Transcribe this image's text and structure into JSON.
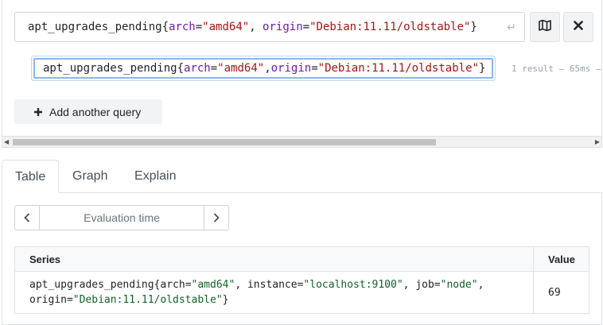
{
  "query": {
    "metric": "apt_upgrades_pending",
    "labels": [
      {
        "name": "arch",
        "value": "\"amd64\""
      },
      {
        "name": "origin",
        "value": "\"Debian:11.11/oldstable\""
      }
    ],
    "open_brace": "{",
    "close_brace": "}",
    "eq": "=",
    "comma_sp": ", ",
    "enter_glyph": "↵"
  },
  "subquery": {
    "metric": "apt_upgrades_pending",
    "open_brace": "{",
    "close_brace": "}",
    "eq": "=",
    "comma": ",",
    "labels": [
      {
        "name": "arch",
        "value": "\"amd64\""
      },
      {
        "name": "origin",
        "value": "\"Debian:11.11/oldstable\""
      }
    ],
    "meta": "1 result – 65ms –"
  },
  "buttons": {
    "add_query": "Add another query",
    "map_icon": "map-icon",
    "close_icon": "close-icon"
  },
  "tabs": [
    {
      "label": "Table",
      "active": true
    },
    {
      "label": "Graph",
      "active": false
    },
    {
      "label": "Explain",
      "active": false
    }
  ],
  "eval_time": {
    "placeholder": "Evaluation time",
    "prev": "‹",
    "next": "›"
  },
  "table": {
    "headers": {
      "series": "Series",
      "value": "Value"
    },
    "rows": [
      {
        "metric": "apt_upgrades_pending",
        "labels": [
          {
            "name": "arch",
            "value": "\"amd64\""
          },
          {
            "name": "instance",
            "value": "\"localhost:9100\""
          },
          {
            "name": "job",
            "value": "\"node\""
          },
          {
            "name": "origin",
            "value": "\"Debian:11.11/oldstable\""
          }
        ],
        "value": "69"
      }
    ]
  }
}
